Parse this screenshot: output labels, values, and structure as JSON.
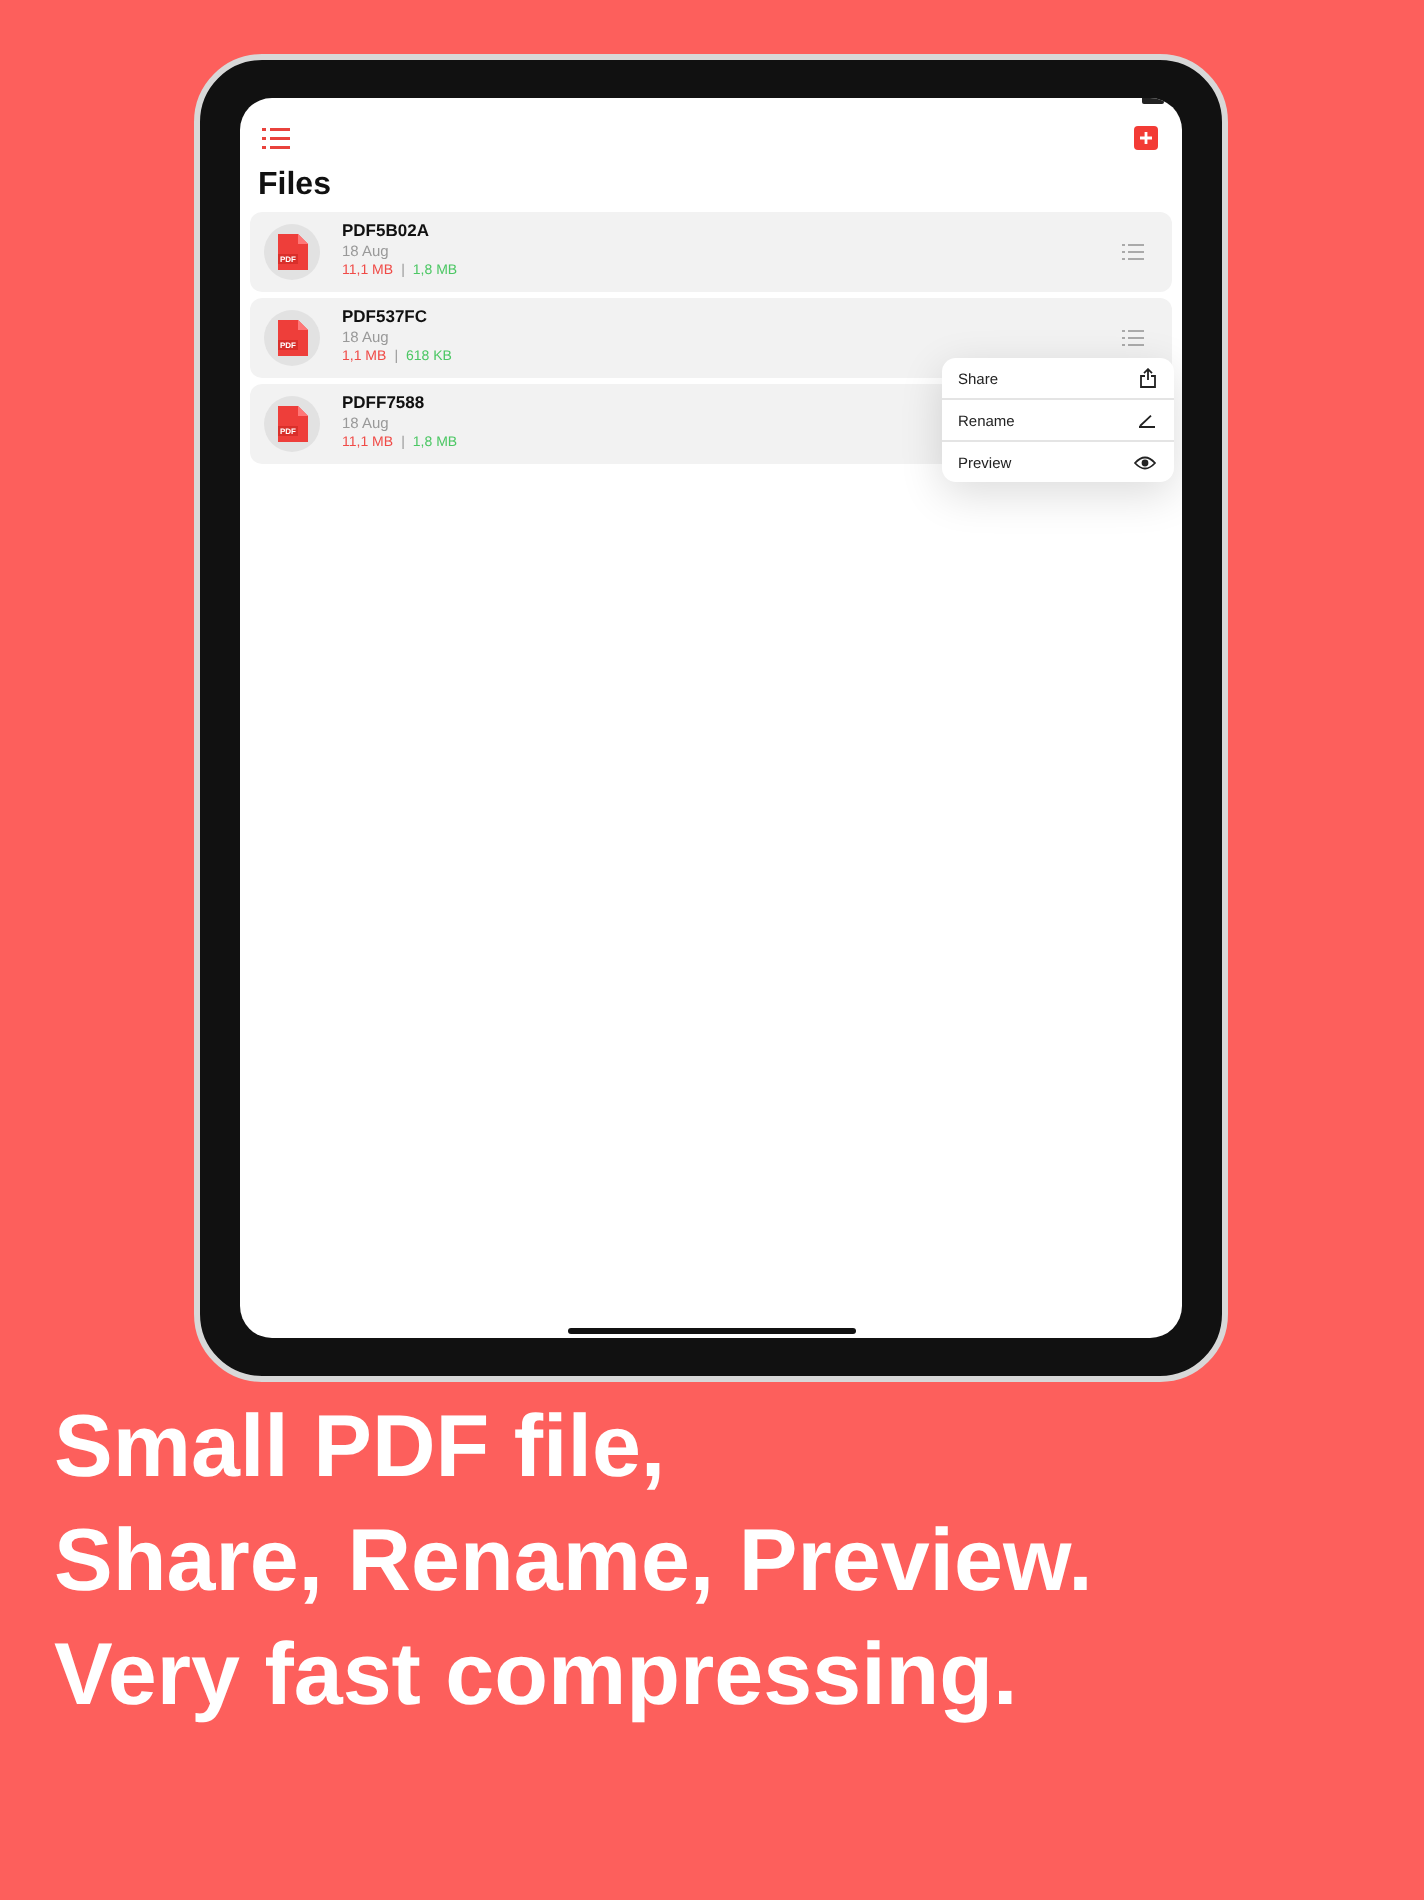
{
  "screen": {
    "title": "Files",
    "files": [
      {
        "name": "PDF5B02A",
        "date": "18 Aug",
        "badge": "PDF",
        "original_size": "11,1 MB",
        "separator": "|",
        "compressed_size": "1,8 MB",
        "options_button": true
      },
      {
        "name": "PDF537FC",
        "date": "18 Aug",
        "badge": "PDF",
        "original_size": "1,1 MB",
        "separator": "|",
        "compressed_size": "618 KB",
        "options_button": true
      },
      {
        "name": "PDFF7588",
        "date": "18 Aug",
        "badge": "PDF",
        "original_size": "11,1 MB",
        "separator": "|",
        "compressed_size": "1,8 MB"
      }
    ],
    "context_menu": {
      "items": [
        {
          "label": "Share",
          "kind": "share"
        },
        {
          "label": "Rename",
          "kind": "rename"
        },
        {
          "label": "Preview",
          "kind": "preview"
        }
      ]
    }
  },
  "caption": [
    "Small PDF file,",
    "Share, Rename, Preview.",
    "Very fast compressing."
  ]
}
